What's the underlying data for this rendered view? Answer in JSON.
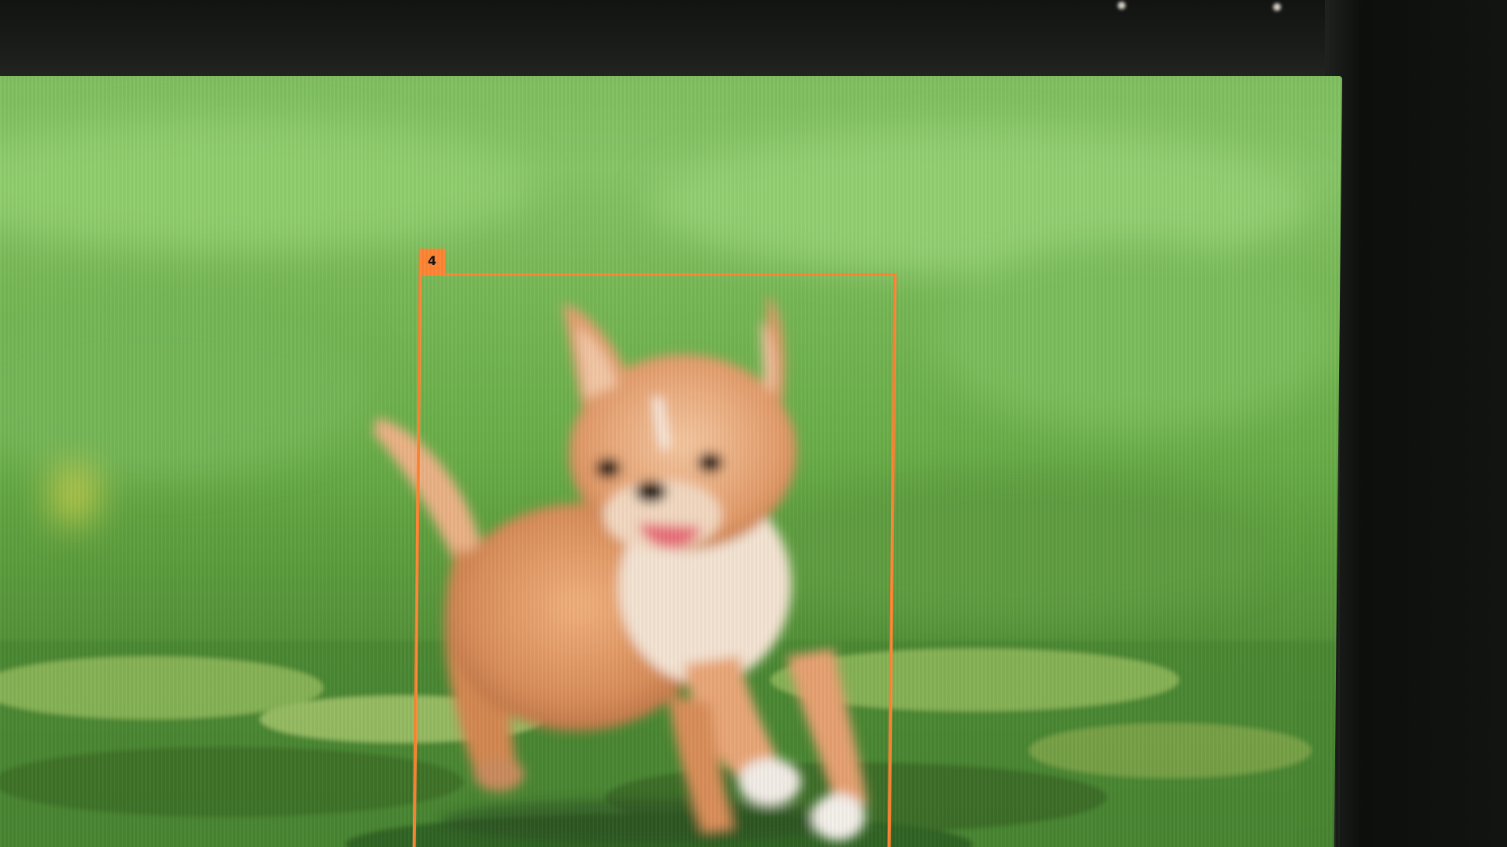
{
  "photo": {
    "subject": "dog",
    "detections": [
      {
        "label": "4",
        "color": "#ff8533"
      }
    ]
  }
}
